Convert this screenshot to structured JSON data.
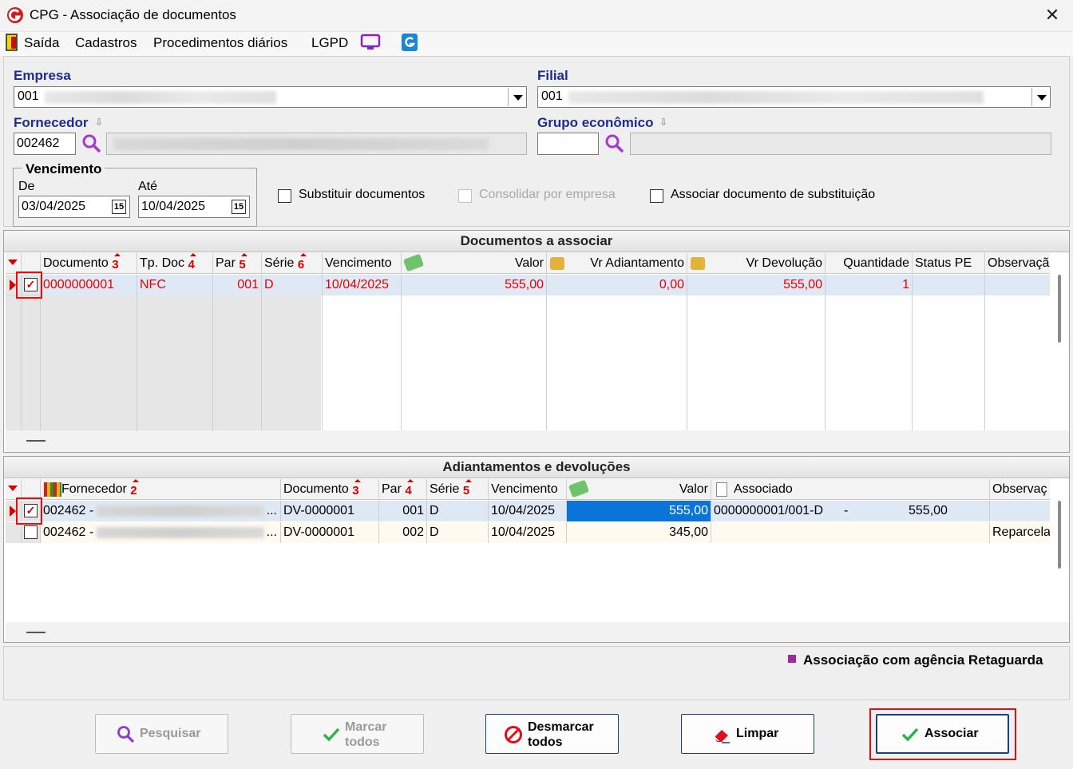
{
  "window": {
    "title": "CPG - Associação de documentos",
    "close": "✕"
  },
  "menu": [
    "Saída",
    "Cadastros",
    "Procedimentos diários",
    "LGPD"
  ],
  "form": {
    "empresa_label": "Empresa",
    "empresa_code": "001",
    "filial_label": "Filial",
    "filial_code": "001",
    "fornecedor_label": "Fornecedor",
    "fornecedor_code": "002462",
    "grupo_label": "Grupo econômico",
    "grupo_code": "",
    "vencimento_label": "Vencimento",
    "de_label": "De",
    "de_value": "03/04/2025",
    "ate_label": "Até",
    "ate_value": "10/04/2025",
    "calendar_glyph": "15",
    "chk_substituir": "Substituir documentos",
    "chk_consolidar": "Consolidar por empresa",
    "chk_associar_subst": "Associar documento de substituição"
  },
  "docs": {
    "title": "Documentos a associar",
    "headers": {
      "documento": "Documento",
      "n3": "3",
      "tpdoc": "Tp. Doc",
      "n4": "4",
      "par": "Par",
      "n5": "5",
      "serie": "Série",
      "n6": "6",
      "vencimento": "Vencimento",
      "valor": "Valor",
      "vr_adiant": "Vr Adiantamento",
      "vr_dev": "Vr Devolução",
      "quantidade": "Quantidade",
      "status": "Status PE",
      "obs": "Observaçã"
    },
    "row": {
      "checked": true,
      "documento": "0000000001",
      "tpdoc": "NFC",
      "par": "001",
      "serie": "D",
      "vencimento": "10/04/2025",
      "valor": "555,00",
      "vr_adiant": "0,00",
      "vr_dev": "555,00",
      "quantidade": "1",
      "status": "",
      "obs": ""
    }
  },
  "adiant": {
    "title": "Adiantamentos e devoluções",
    "headers": {
      "fornecedor": "Fornecedor",
      "n2": "2",
      "documento": "Documento",
      "n3": "3",
      "par": "Par",
      "n4": "4",
      "serie": "Série",
      "n5": "5",
      "vencimento": "Vencimento",
      "valor": "Valor",
      "associado": "Associado",
      "obs": "Observaç"
    },
    "rows": [
      {
        "checked": true,
        "fornecedor": "002462 -",
        "ellipsis": "...",
        "documento": "DV-0000001",
        "par": "001",
        "serie": "D",
        "vencimento": "10/04/2025",
        "valor": "555,00",
        "associado_doc": "0000000001/001-D",
        "associado_sep": "-",
        "associado_valor": "555,00",
        "obs": ""
      },
      {
        "checked": false,
        "fornecedor": "002462 -",
        "ellipsis": "...",
        "documento": "DV-0000001",
        "par": "002",
        "serie": "D",
        "vencimento": "10/04/2025",
        "valor": "345,00",
        "associado_doc": "",
        "associado_sep": "",
        "associado_valor": "",
        "obs": "Reparcela"
      }
    ]
  },
  "legend": {
    "text": "Associação com agência Retaguarda",
    "color": "#9b2c9b"
  },
  "buttons": {
    "pesquisar": "Pesquisar",
    "marcar_l1": "Marcar",
    "marcar_l2": "todos",
    "desmarcar_l1": "Desmarcar",
    "desmarcar_l2": "todos",
    "limpar": "Limpar",
    "associar": "Associar"
  }
}
